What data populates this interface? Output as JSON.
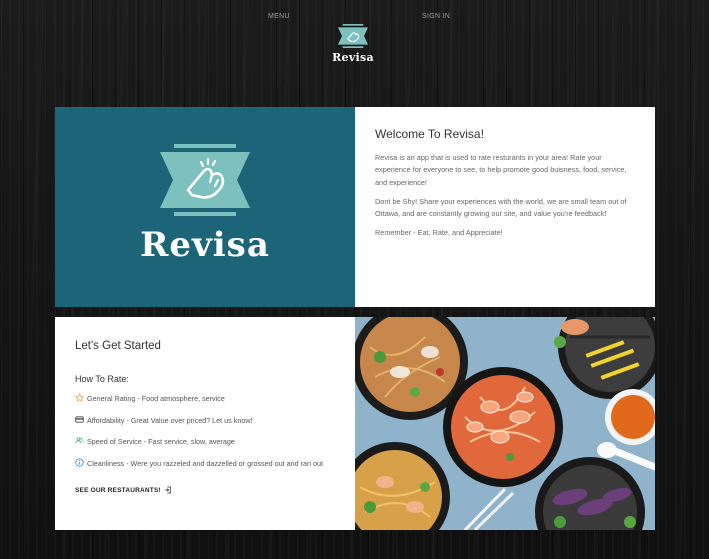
{
  "nav": {
    "menu_label": "MENU",
    "signin_label": "SIGN IN",
    "logo_text": "Revisa"
  },
  "hero": {
    "brand_text": "Revisa",
    "colors": {
      "panel": "#1c6478",
      "ribbon": "#7cc1bd",
      "ribbon_dark": "#3e8f8c"
    }
  },
  "welcome": {
    "title": "Welcome To Revisa!",
    "paragraphs": [
      "Revisa is an app that is used to rate resturants in your area! Rate your experience for everyone to see, to help promote good buisness, food, service, and experience!",
      "Dont be Shy! Share your experiences with the world, we are small team out of Ottawa, and are constantly growing our site, and value you're feedback!",
      "Remember - Eat, Rate, and Appreciate!"
    ]
  },
  "started": {
    "title": "Let's Get Started",
    "subtitle": "How To Rate:",
    "items": [
      {
        "icon": "star-icon",
        "color": "#e8a24a",
        "text": "General Rating - Food atmosphere, service"
      },
      {
        "icon": "credit-card-icon",
        "color": "#222222",
        "text": "Affordability - Great Value over priced? Let us know!"
      },
      {
        "icon": "people-icon",
        "color": "#4caf6a",
        "text": "Speed of Service - Fast service, slow, average"
      },
      {
        "icon": "info-icon",
        "color": "#2f7fd0",
        "text": "Cleanliness - Were you razzeled and dazzelled or grossed out and ran out"
      }
    ],
    "cta_label": "SEE OUR RESTAURANTS!",
    "cta_icon": "enter-icon"
  },
  "food_image": {
    "icon": "food-photo"
  }
}
